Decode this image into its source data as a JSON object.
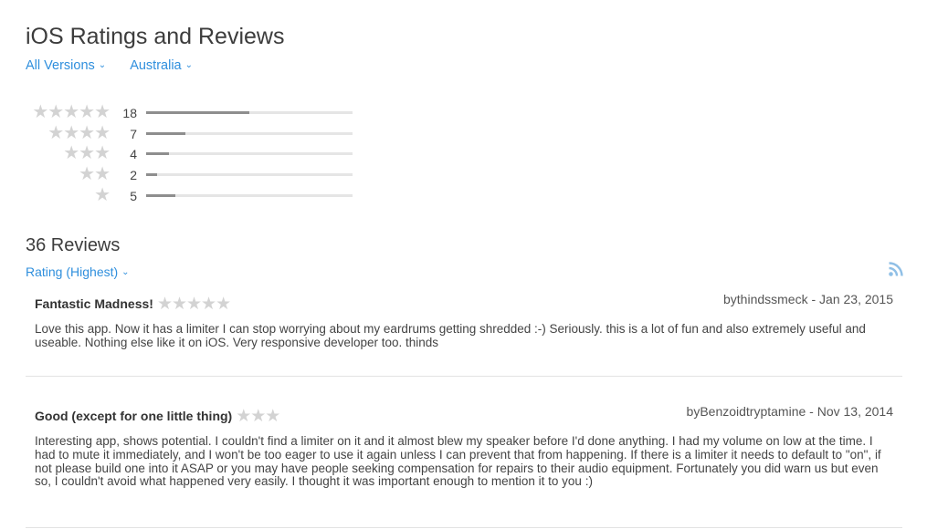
{
  "page": {
    "title": "iOS Ratings and Reviews",
    "filters": {
      "version": "All Versions",
      "region": "Australia",
      "chevron": "⌄"
    }
  },
  "distribution": [
    {
      "stars": "★★★★★",
      "count": "18",
      "fraction": 0.5
    },
    {
      "stars": "★★★★",
      "count": "7",
      "fraction": 0.19
    },
    {
      "stars": "★★★",
      "count": "4",
      "fraction": 0.11
    },
    {
      "stars": "★★",
      "count": "2",
      "fraction": 0.055
    },
    {
      "stars": "★",
      "count": "5",
      "fraction": 0.14
    }
  ],
  "reviews_header": {
    "count_label": "36 Reviews",
    "sort_label": "Rating (Highest)",
    "rss_icon": "rss-icon"
  },
  "reviews": [
    {
      "title": "Fantastic Madness!",
      "stars": "★★★★★",
      "meta": "bythindssmeck - Jan 23, 2015",
      "body": "Love this app. Now it has a limiter I can stop worrying about my eardrums getting shredded :-) Seriously. this is a lot of fun and also extremely useful and useable. Nothing else like it on iOS. Very responsive developer too. thinds"
    },
    {
      "title": "Good (except for one little thing)",
      "stars": "★★★",
      "meta": "byBenzoidtryptamine - Nov 13, 2014",
      "body": "Interesting app, shows potential. I couldn't find a limiter on it and it almost blew my speaker before I'd done anything. I had my volume on low at the time. I had to mute it immediately, and I won't be too eager to use it again unless I can prevent that from happening. If there is a limiter it needs to default to \"on\", if not please build one into it ASAP or you may have people seeking compensation for repairs to their audio equipment. Fortunately you did warn us but even so, I couldn't avoid what happened very easily. I thought it was important enough to mention it to you :)"
    }
  ],
  "colors": {
    "link": "#2f8fdd",
    "star": "#d3d3d3",
    "bar_fill": "#8e8e8e",
    "bar_track": "#e5e5e5"
  }
}
